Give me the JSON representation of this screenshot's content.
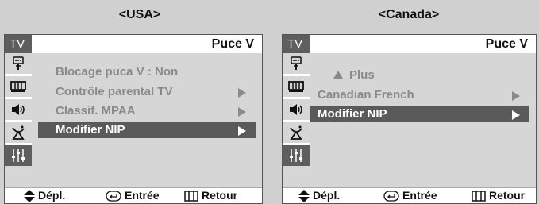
{
  "regions": {
    "usa": {
      "title": "<USA>",
      "tv_label": "TV",
      "header": "Puce V",
      "items": [
        {
          "label": "Blocage puca V  :  Non",
          "arrow": false,
          "selected": false
        },
        {
          "label": "Contrôle parental TV",
          "arrow": true,
          "selected": false
        },
        {
          "label": "Classif. MPAA",
          "arrow": true,
          "selected": false
        },
        {
          "label": "Modifier NIP",
          "arrow": true,
          "selected": true
        }
      ],
      "footer": {
        "move": "Dépl.",
        "enter": "Entrée",
        "return": "Retour"
      }
    },
    "canada": {
      "title": "<Canada>",
      "tv_label": "TV",
      "header": "Puce V",
      "items": [
        {
          "label": "Plus",
          "arrow": false,
          "selected": false,
          "up": true
        },
        {
          "label": "Canadian French",
          "arrow": true,
          "selected": false
        },
        {
          "label": "Modifier NIP",
          "arrow": true,
          "selected": true
        }
      ],
      "footer": {
        "move": "Dépl.",
        "enter": "Entrée",
        "return": "Retour"
      }
    }
  },
  "sidebar_icons": [
    "input-icon",
    "picture-icon",
    "sound-icon",
    "channel-icon",
    "setup-icon"
  ],
  "colors": {
    "panel_bg": "#d6d6d6",
    "highlight": "#5a5a5a",
    "inactive_text": "#8a8a8a"
  }
}
